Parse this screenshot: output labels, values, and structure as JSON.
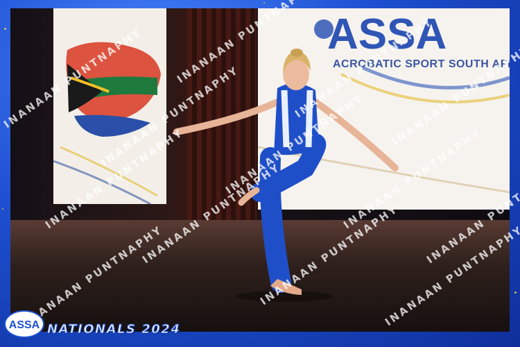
{
  "banner": {
    "org_name": "ACROBATIC SPORT SOUTH AFR"
  },
  "footer": {
    "logo_text": "ASSA",
    "event_title": "NATIONALS 2024"
  },
  "watermark": {
    "text": "INANAAN PUNTNAPHY"
  },
  "colors": {
    "frame_blue": "#1d4fd0",
    "leotard_blue": "#1f4fc8",
    "banner_blue": "#3a56a0"
  }
}
